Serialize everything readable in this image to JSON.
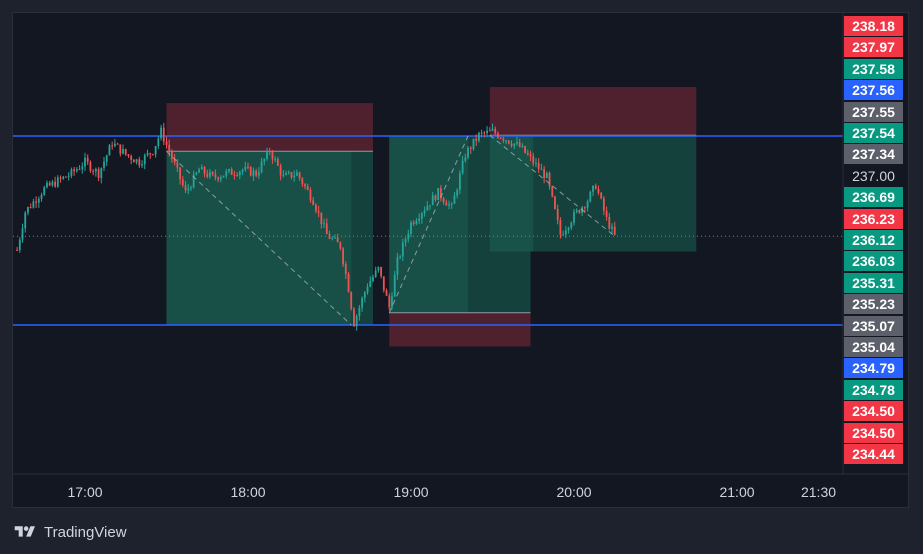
{
  "brand": {
    "name": "TradingView",
    "icon": "tradingview-logo-icon"
  },
  "colors": {
    "up": "#26a69a",
    "down": "#ef5350",
    "level_line": "#2962ff",
    "last_price": "#ef5350",
    "gray_tag": "#5d606b",
    "green_tag": "#089981",
    "red_tag": "#f23645",
    "blue_tag": "#2962ff"
  },
  "chart_data": {
    "type": "candlestick",
    "x_axis": {
      "ticks": [
        "17:00",
        "18:00",
        "19:00",
        "20:00",
        "21:00",
        "21:30"
      ],
      "range": [
        "16:35",
        "21:35"
      ]
    },
    "y_axis": {
      "range": [
        233.8,
        238.5
      ]
    },
    "last_price": 236.23,
    "horizontal_levels": [
      237.54,
      235.07
    ],
    "price_tags": [
      {
        "value": "238.18",
        "color": "red"
      },
      {
        "value": "237.97",
        "color": "red"
      },
      {
        "value": "237.58",
        "color": "green"
      },
      {
        "value": "237.56",
        "color": "blue"
      },
      {
        "value": "237.55",
        "color": "gray"
      },
      {
        "value": "237.54",
        "color": "green"
      },
      {
        "value": "237.34",
        "color": "gray"
      },
      {
        "value": "237.00",
        "color": "none"
      },
      {
        "value": "236.69",
        "color": "green"
      },
      {
        "value": "236.23",
        "color": "red"
      },
      {
        "value": "236.12",
        "color": "green"
      },
      {
        "value": "236.03",
        "color": "green"
      },
      {
        "value": "235.31",
        "color": "green"
      },
      {
        "value": "235.23",
        "color": "gray"
      },
      {
        "value": "235.07",
        "color": "gray"
      },
      {
        "value": "235.04",
        "color": "gray"
      },
      {
        "value": "234.79",
        "color": "blue"
      },
      {
        "value": "234.78",
        "color": "green"
      },
      {
        "value": "234.50",
        "color": "red"
      },
      {
        "value": "234.50",
        "color": "red"
      },
      {
        "value": "234.44",
        "color": "red"
      }
    ],
    "positions": [
      {
        "side": "short",
        "start": "17:30",
        "end": "18:46",
        "entry": 237.34,
        "stop": 237.97,
        "target": 235.07,
        "closed": "18:38"
      },
      {
        "side": "long",
        "start": "18:52",
        "end": "19:44",
        "entry": 235.23,
        "stop": 234.79,
        "target": 237.54,
        "closed": "19:21"
      },
      {
        "side": "short",
        "start": "19:29",
        "end": "20:45",
        "entry": 237.55,
        "stop": 238.18,
        "target": 236.03,
        "closed": "19:45"
      }
    ],
    "trade_paths": [
      [
        [
          "17:30",
          237.34
        ],
        [
          "18:38",
          235.07
        ]
      ],
      [
        [
          "18:52",
          235.23
        ],
        [
          "19:21",
          237.54
        ]
      ],
      [
        [
          "19:29",
          237.55
        ],
        [
          "20:15",
          236.23
        ]
      ]
    ],
    "price_path": [
      [
        "16:35",
        236.05
      ],
      [
        "16:38",
        236.55
      ],
      [
        "16:45",
        236.85
      ],
      [
        "16:55",
        237.05
      ],
      [
        "17:00",
        237.2
      ],
      [
        "17:05",
        237.05
      ],
      [
        "17:10",
        237.45
      ],
      [
        "17:15",
        237.3
      ],
      [
        "17:20",
        237.2
      ],
      [
        "17:25",
        237.35
      ],
      [
        "17:28",
        237.6
      ],
      [
        "17:32",
        237.25
      ],
      [
        "17:37",
        236.8
      ],
      [
        "17:42",
        237.1
      ],
      [
        "17:47",
        237.0
      ],
      [
        "17:52",
        237.05
      ],
      [
        "17:58",
        237.1
      ],
      [
        "18:03",
        237.05
      ],
      [
        "18:08",
        237.35
      ],
      [
        "18:13",
        237.0
      ],
      [
        "18:18",
        237.05
      ],
      [
        "18:24",
        236.7
      ],
      [
        "18:29",
        236.25
      ],
      [
        "18:34",
        236.1
      ],
      [
        "18:37",
        235.55
      ],
      [
        "18:39",
        235.1
      ],
      [
        "18:44",
        235.6
      ],
      [
        "18:48",
        235.8
      ],
      [
        "18:52",
        235.3
      ],
      [
        "18:55",
        235.9
      ],
      [
        "19:00",
        236.4
      ],
      [
        "19:05",
        236.6
      ],
      [
        "19:10",
        236.8
      ],
      [
        "19:15",
        236.6
      ],
      [
        "19:20",
        237.3
      ],
      [
        "19:25",
        237.55
      ],
      [
        "19:30",
        237.6
      ],
      [
        "19:35",
        237.5
      ],
      [
        "19:40",
        237.4
      ],
      [
        "19:45",
        237.2
      ],
      [
        "19:50",
        237.0
      ],
      [
        "19:55",
        236.25
      ],
      [
        "20:00",
        236.5
      ],
      [
        "20:05",
        236.7
      ],
      [
        "20:08",
        236.9
      ],
      [
        "20:12",
        236.45
      ],
      [
        "20:15",
        236.23
      ]
    ]
  }
}
